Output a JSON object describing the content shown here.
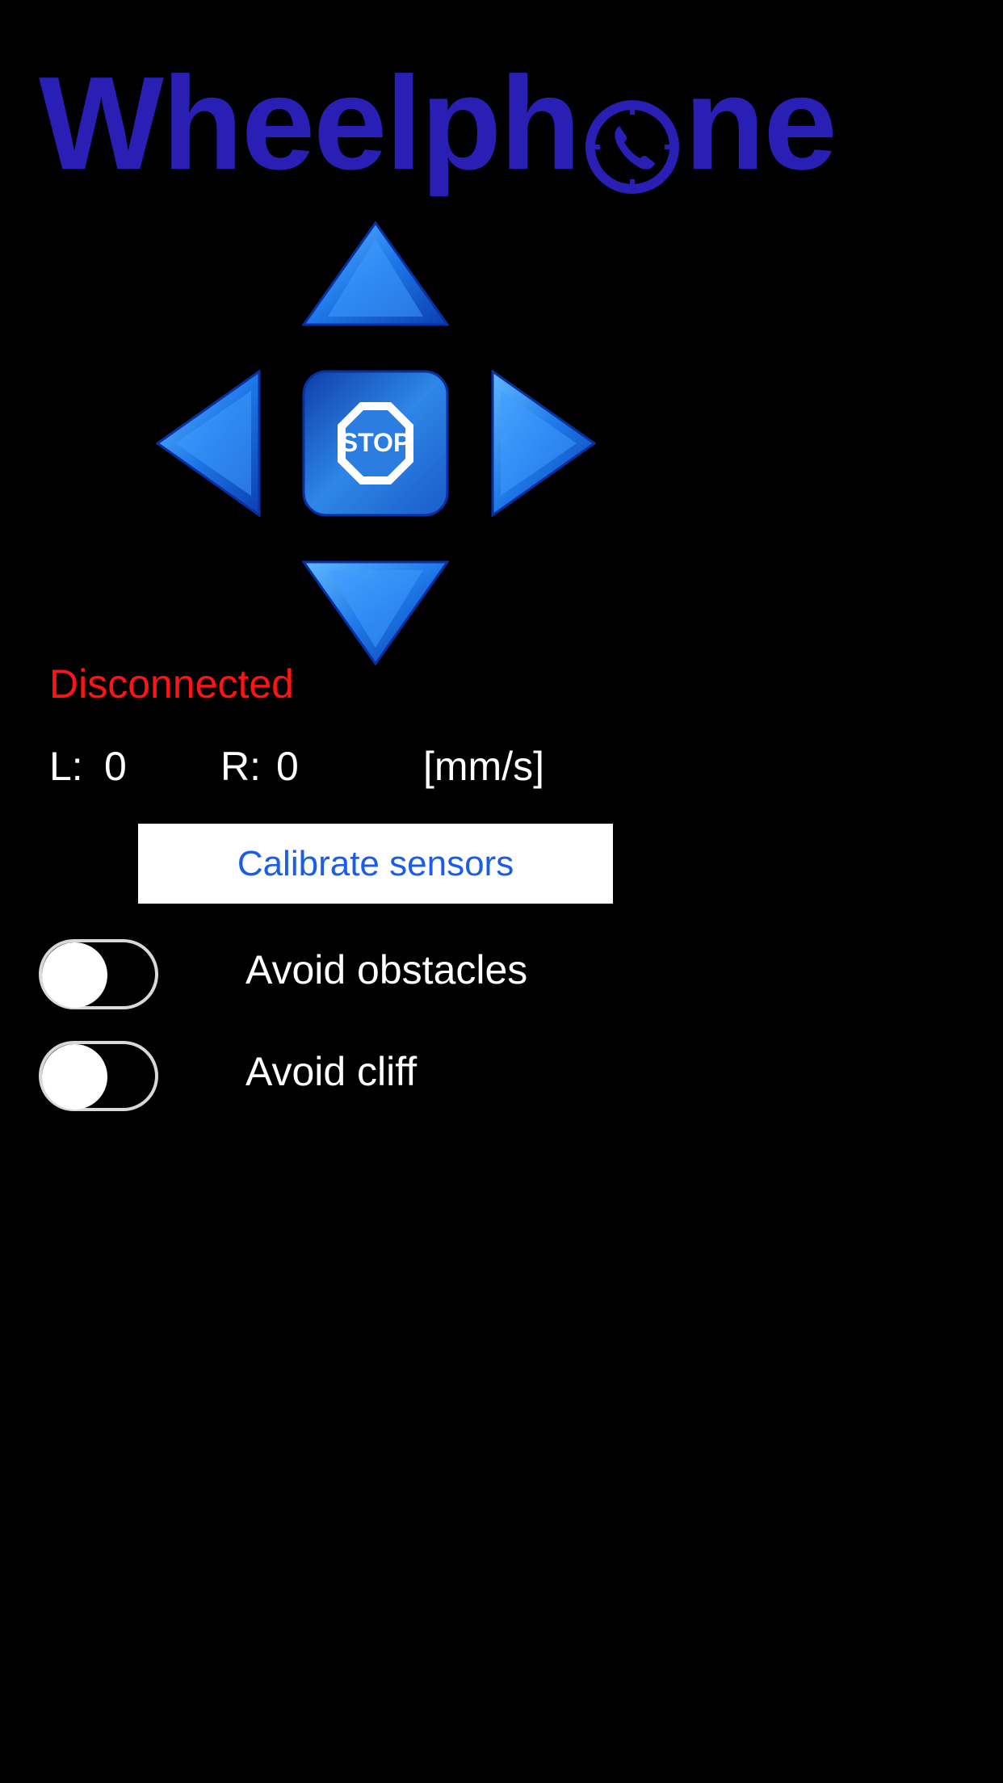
{
  "app": {
    "logo_text_before": "Wheelph",
    "logo_text_after": "ne",
    "logo_icon": "phone-dial-icon",
    "brand_color": "#2a1fb4"
  },
  "controls": {
    "up_icon": "arrow-up-icon",
    "down_icon": "arrow-down-icon",
    "left_icon": "arrow-left-icon",
    "right_icon": "arrow-right-icon",
    "stop_label": "STOP",
    "button_color": "#1e6fe0"
  },
  "status": {
    "text": "Disconnected",
    "color": "#ff1414"
  },
  "speed": {
    "left_label": "L:",
    "left_value": "0",
    "right_label": "R:",
    "right_value": "0",
    "unit": "[mm/s]"
  },
  "calibrate": {
    "label": "Calibrate sensors"
  },
  "toggles": [
    {
      "label": "Avoid obstacles",
      "on": false
    },
    {
      "label": "Avoid cliff",
      "on": false
    }
  ]
}
